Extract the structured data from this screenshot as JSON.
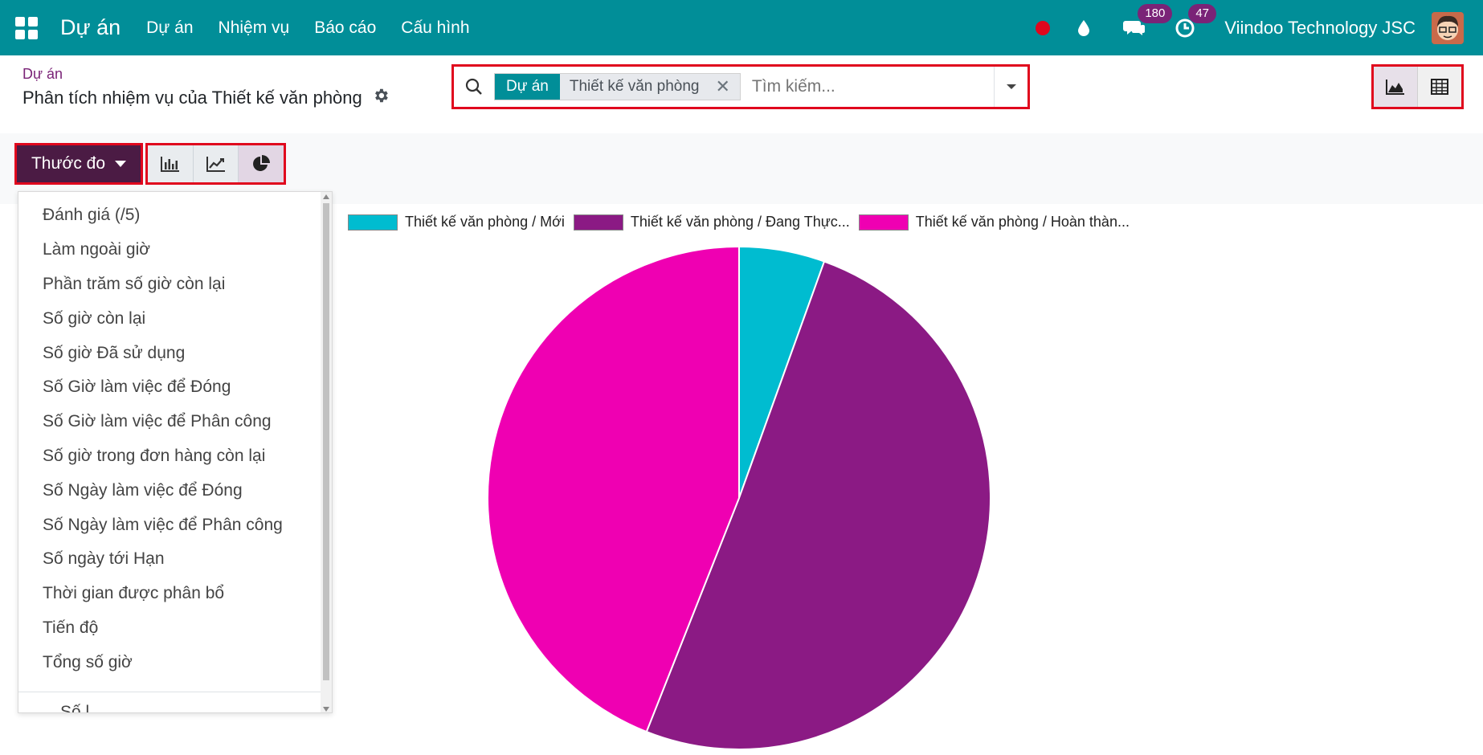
{
  "navbar": {
    "brand": "Dự án",
    "menu": [
      "Dự án",
      "Nhiệm vụ",
      "Báo cáo",
      "Cấu hình"
    ],
    "messages_count": "180",
    "activities_count": "47",
    "company": "Viindoo Technology JSC"
  },
  "breadcrumb": {
    "parent": "Dự án",
    "title": "Phân tích nhiệm vụ của Thiết kế văn phòng"
  },
  "search": {
    "facet_label": "Dự án",
    "facet_value": "Thiết kế văn phòng",
    "placeholder": "Tìm kiếm..."
  },
  "toolbar": {
    "measure_label": "Thước đo"
  },
  "measures": [
    "Đánh giá (/5)",
    "Làm ngoài giờ",
    "Phần trăm số giờ còn lại",
    "Số giờ còn lại",
    "Số giờ Đã sử dụng",
    "Số Giờ làm việc để Đóng",
    "Số Giờ làm việc để Phân công",
    "Số giờ trong đơn hàng còn lại",
    "Số Ngày làm việc để Đóng",
    "Số Ngày làm việc để Phân công",
    "Số ngày tới Hạn",
    "Thời gian được phân bổ",
    "Tiến độ",
    "Tổng số giờ"
  ],
  "measures_cut_off": "Số l",
  "chart_data": {
    "type": "pie",
    "labels": [
      "Thiết kế văn phòng / Mới",
      "Thiết kế văn phòng / Đang Thực...",
      "Thiết kế văn phòng / Hoàn thàn..."
    ],
    "values": [
      5.5,
      50.5,
      44.0
    ],
    "colors": [
      "#00bcd0",
      "#8b1a84",
      "#ef00b2"
    ],
    "legend_position": "top-left"
  }
}
